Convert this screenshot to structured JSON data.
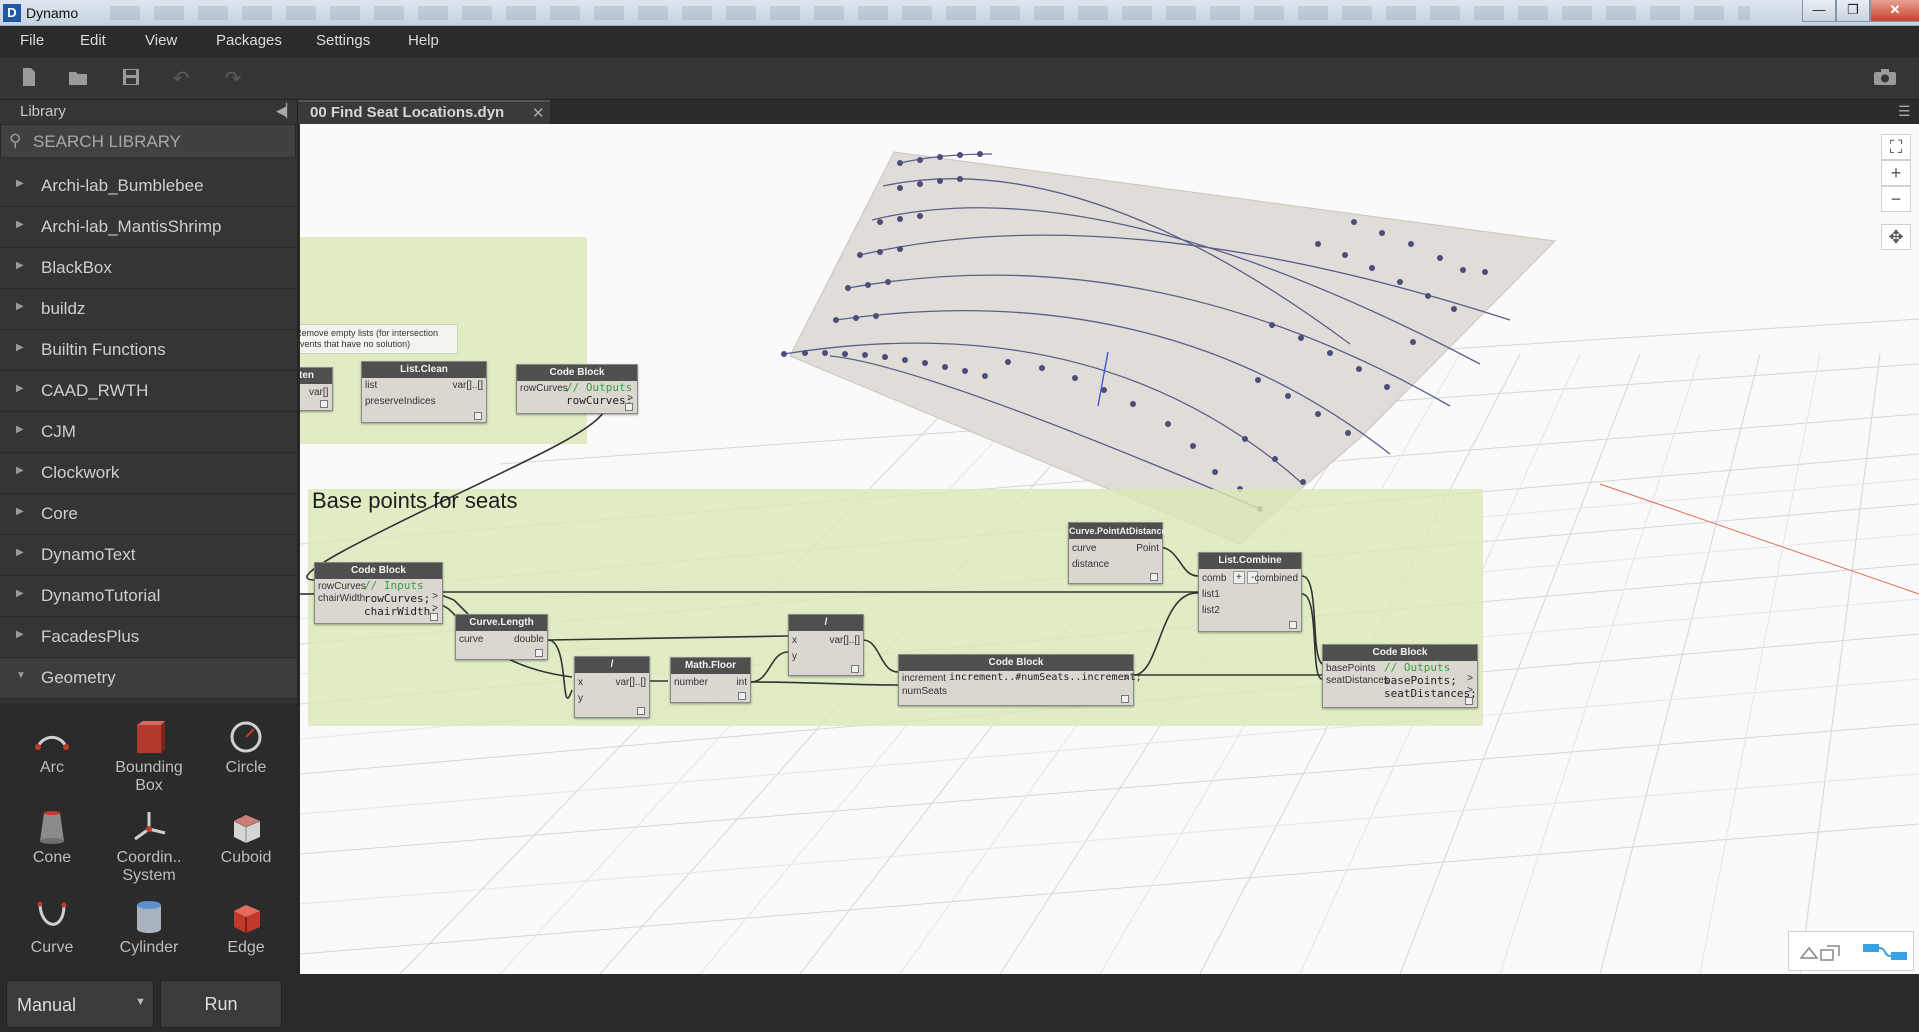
{
  "window": {
    "title": "Dynamo",
    "minimize": "—",
    "restore": "❐",
    "close": "✕"
  },
  "menu": {
    "items": [
      "File",
      "Edit",
      "View",
      "Packages",
      "Settings",
      "Help"
    ]
  },
  "library": {
    "title": "Library",
    "search_placeholder": "SEARCH LIBRARY",
    "categories": [
      "Archi-lab_Bumblebee",
      "Archi-lab_MantisShrimp",
      "BlackBox",
      "buildz",
      "Builtin Functions",
      "CAAD_RWTH",
      "CJM",
      "Clockwork",
      "Core",
      "DynamoText",
      "DynamoTutorial",
      "FacadesPlus",
      "Geometry"
    ],
    "geometry_items": [
      {
        "label": "Arc",
        "icon": "arc-icon"
      },
      {
        "label": "Bounding Box",
        "icon": "bounding-box-icon"
      },
      {
        "label": "Circle",
        "icon": "circle-icon"
      },
      {
        "label": "Cone",
        "icon": "cone-icon"
      },
      {
        "label": "Coordin.. System",
        "icon": "coordinate-system-icon"
      },
      {
        "label": "Cuboid",
        "icon": "cuboid-icon"
      },
      {
        "label": "Curve",
        "icon": "curve-icon"
      },
      {
        "label": "Cylinder",
        "icon": "cylinder-icon"
      },
      {
        "label": "Edge",
        "icon": "edge-icon"
      }
    ]
  },
  "tab": {
    "label": "00 Find Seat Locations.dyn",
    "close": "✕"
  },
  "bottom": {
    "run_mode": "Manual",
    "run_label": "Run"
  },
  "canvas": {
    "group_title": "Base points for seats",
    "note": "Remove empty lists (for intersection events that have no solution)",
    "nodes": {
      "flatten": {
        "title": "ten",
        "out": "var[]"
      },
      "list_clean": {
        "title": "List.Clean",
        "in1": "list",
        "in2": "preserveIndices",
        "out": "var[]..[]"
      },
      "code_block_1": {
        "title": "Code Block",
        "in1": "rowCurves",
        "line1": "// Outputs",
        "line2": "rowCurves;",
        "out": ">"
      },
      "code_block_2": {
        "title": "Code Block",
        "in1": "rowCurves",
        "in2": "chairWidth",
        "line1": "// Inputs",
        "line2": "rowCurves;",
        "line3": "chairWidth;",
        "out1": ">",
        "out2": ">"
      },
      "curve_length": {
        "title": "Curve.Length",
        "in": "curve",
        "out": "double"
      },
      "divide_1": {
        "title": "/",
        "in1": "x",
        "in2": "y",
        "out": "var[]..[]"
      },
      "math_floor": {
        "title": "Math.Floor",
        "in": "number",
        "out": "int"
      },
      "divide_2": {
        "title": "/",
        "in1": "x",
        "in2": "y",
        "out": "var[]..[]"
      },
      "code_block_3": {
        "title": "Code Block",
        "in1": "increment",
        "in2": "numSeats",
        "line1": "increment..#numSeats..increment;",
        "out": ">"
      },
      "curve_pad": {
        "title": "Curve.PointAtDistance",
        "in1": "curve",
        "in2": "distance",
        "out": "Point"
      },
      "list_combine": {
        "title": "List.Combine",
        "in1": "comb",
        "in2": "list1",
        "in3": "list2",
        "plus": "+",
        "minus": "-",
        "out": "combined"
      },
      "code_block_4": {
        "title": "Code Block",
        "in1": "basePoints",
        "in2": "seatDistances",
        "line1": "// Outputs",
        "line2": "basePoints;",
        "line3": "seatDistances;",
        "out1": ">",
        "out2": ">"
      }
    }
  }
}
